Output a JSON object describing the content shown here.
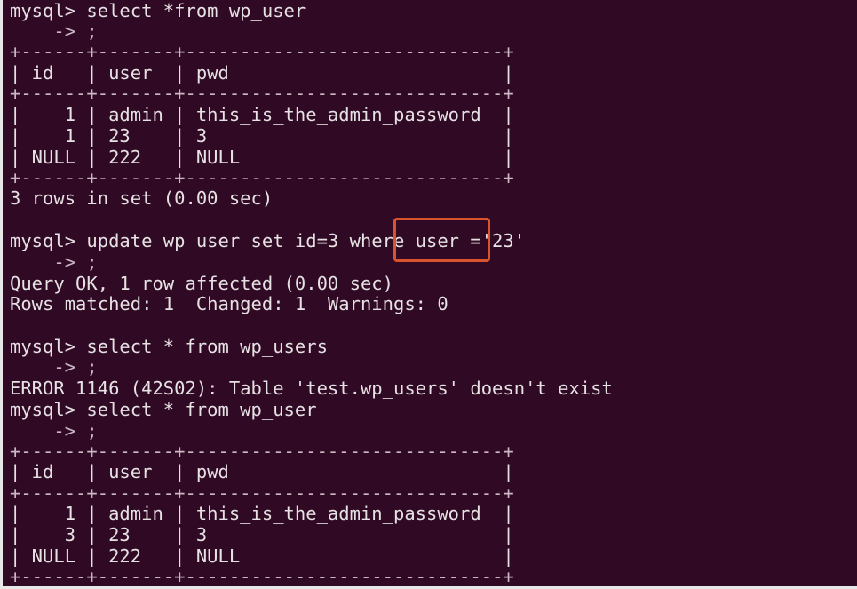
{
  "terminal": {
    "lines": [
      "mysql> select *from wp_user",
      "    -> ;",
      "+------+-------+-----------------------------+",
      "| id   | user  | pwd                         |",
      "+------+-------+-----------------------------+",
      "|    1 | admin | this_is_the_admin_password  |",
      "|    1 | 23    | 3                           |",
      "| NULL | 222   | NULL                        |",
      "+------+-------+-----------------------------+",
      "3 rows in set (0.00 sec)",
      "",
      "mysql> update wp_user set id=3 where user ='23'",
      "    -> ;",
      "Query OK, 1 row affected (0.00 sec)",
      "Rows matched: 1  Changed: 1  Warnings: 0",
      "",
      "mysql> select * from wp_users",
      "    -> ;",
      "ERROR 1146 (42S02): Table 'test.wp_users' doesn't exist",
      "mysql> select * from wp_user",
      "    -> ;",
      "+------+-------+-----------------------------+",
      "| id   | user  | pwd                         |",
      "+------+-------+-----------------------------+",
      "|    1 | admin | this_is_the_admin_password  |",
      "|    3 | 23    | 3                           |",
      "| NULL | 222   | NULL                        |",
      "+------+-------+-----------------------------+"
    ]
  },
  "colors": {
    "background": "#300a24",
    "text": "#e6e1e3",
    "highlight": "#d9532c"
  }
}
